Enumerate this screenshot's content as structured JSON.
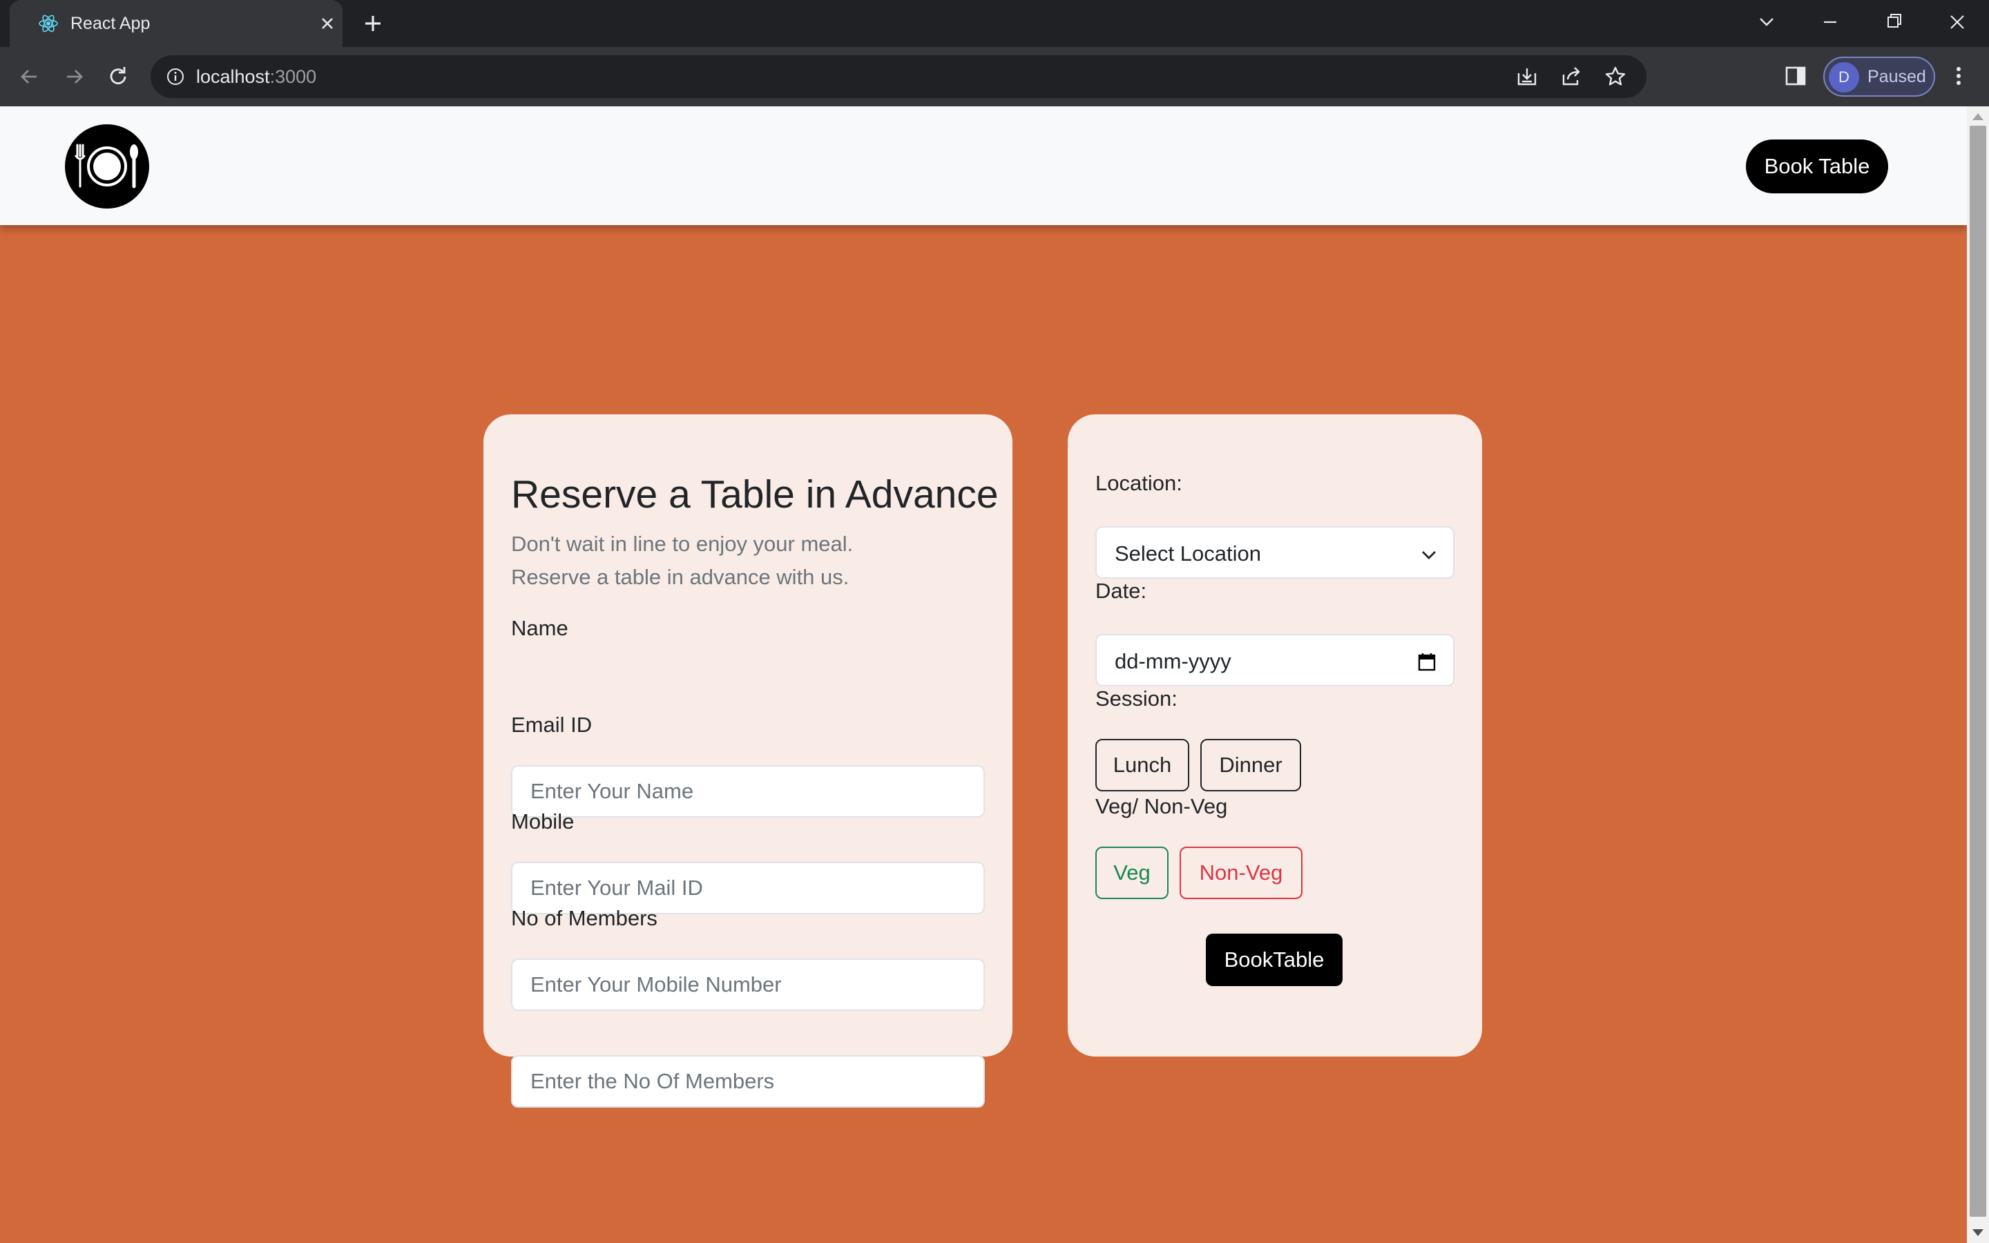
{
  "browser": {
    "tab_title": "React App",
    "url_host": "localhost",
    "url_port": ":3000",
    "profile_initial": "D",
    "profile_status": "Paused",
    "icons": [
      "react-favicon",
      "close-icon",
      "plus-icon",
      "chevron-down-icon",
      "minimize-icon",
      "restore-icon",
      "close-window-icon",
      "back-icon",
      "forward-icon",
      "reload-icon",
      "info-icon",
      "install-icon",
      "share-icon",
      "star-icon",
      "sidepanel-icon",
      "menu-icon"
    ]
  },
  "header": {
    "logo_icon": "plate-fork-spoon-icon",
    "book_button": "Book Table"
  },
  "form": {
    "title": "Reserve a Table in Advance",
    "subtitle_line1": "Don't wait in line to enjoy your meal.",
    "subtitle_line2": "Reserve a table in advance with us.",
    "name_label": "Name",
    "name_placeholder": "Enter Your Name",
    "email_label": "Email ID",
    "email_placeholder": "Enter Your Mail ID",
    "mobile_label": "Mobile",
    "mobile_placeholder": "Enter Your Mobile Number",
    "members_label": "No of Members",
    "members_placeholder": "Enter the No Of Members"
  },
  "booking": {
    "location_label": "Location:",
    "location_value": "Select Location",
    "date_label": "Date:",
    "date_value": "dd-mm-yyyy",
    "session_label": "Session:",
    "session_options": [
      "Lunch",
      "Dinner"
    ],
    "diet_label": "Veg/ Non-Veg",
    "diet_options": [
      "Veg",
      "Non-Veg"
    ],
    "submit_label": "BookTable"
  },
  "colors": {
    "page_bg": "#d2693a",
    "card_bg": "#f9ece6",
    "veg": "#198754",
    "nonveg": "#dc3545"
  }
}
